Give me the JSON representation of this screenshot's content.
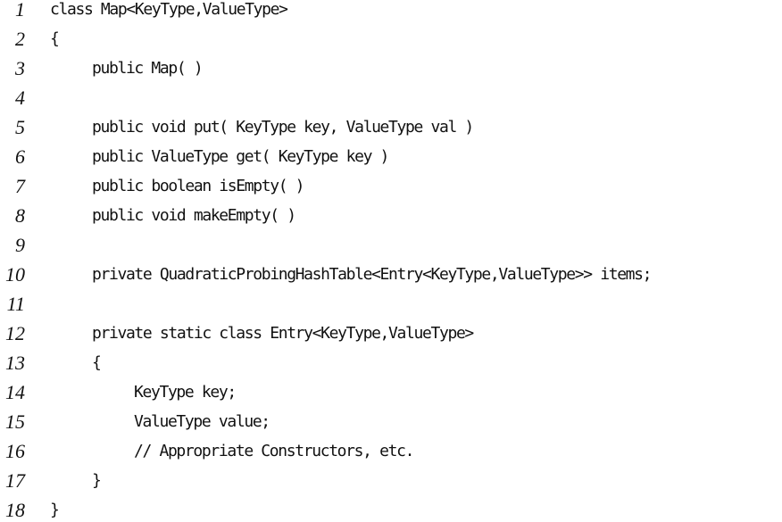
{
  "listing": {
    "lines": [
      {
        "number": "1",
        "code": "class Map<KeyType,ValueType>"
      },
      {
        "number": "2",
        "code": "{"
      },
      {
        "number": "3",
        "code": "public Map( )"
      },
      {
        "number": "4",
        "code": ""
      },
      {
        "number": "5",
        "code": "public void put( KeyType key, ValueType val )"
      },
      {
        "number": "6",
        "code": "public ValueType get( KeyType key )"
      },
      {
        "number": "7",
        "code": "public boolean isEmpty( )"
      },
      {
        "number": "8",
        "code": "public void makeEmpty( )"
      },
      {
        "number": "9",
        "code": ""
      },
      {
        "number": "10",
        "code": "private QuadraticProbingHashTable<Entry<KeyType,ValueType>> items;"
      },
      {
        "number": "11",
        "code": ""
      },
      {
        "number": "12",
        "code": "private static class Entry<KeyType,ValueType>"
      },
      {
        "number": "13",
        "code": "{"
      },
      {
        "number": "14",
        "code": "KeyType key;"
      },
      {
        "number": "15",
        "code": "ValueType value;"
      },
      {
        "number": "16",
        "code": "// Appropriate Constructors, etc."
      },
      {
        "number": "17",
        "code": "}"
      },
      {
        "number": "18",
        "code": "}"
      }
    ]
  }
}
